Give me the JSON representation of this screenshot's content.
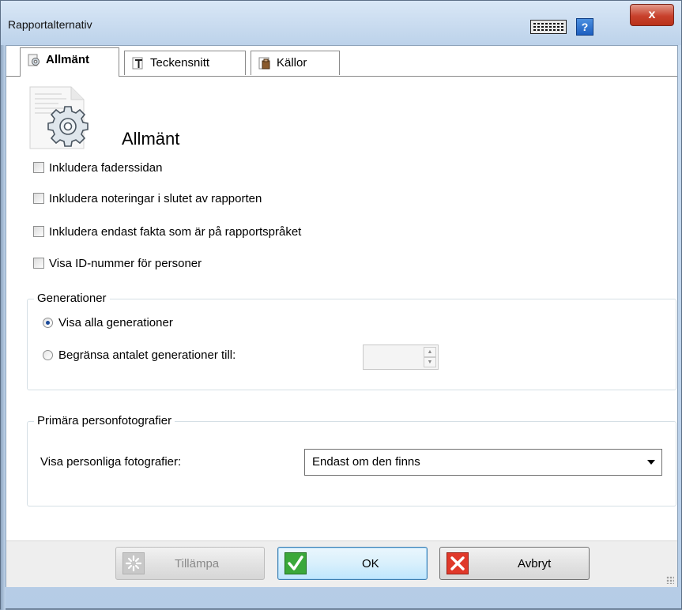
{
  "window": {
    "title": "Rapportalternativ",
    "close_label": "x",
    "help_label": "?"
  },
  "tabs": [
    {
      "label": "Allmänt"
    },
    {
      "label": "Teckensnitt"
    },
    {
      "label": "Källor"
    }
  ],
  "section": {
    "title": "Allmänt"
  },
  "checkboxes": [
    {
      "label": "Inkludera faderssidan",
      "checked": false
    },
    {
      "label": "Inkludera noteringar i slutet av rapporten",
      "checked": false
    },
    {
      "label": "Inkludera endast fakta som är på rapportspråket",
      "checked": false
    },
    {
      "label": "Visa ID-nummer för personer",
      "checked": false
    }
  ],
  "generations": {
    "legend": "Generationer",
    "options": [
      {
        "label": "Visa alla generationer",
        "selected": true
      },
      {
        "label": "Begränsa antalet generationer till:",
        "selected": false
      }
    ],
    "limit_value": ""
  },
  "photos": {
    "legend": "Primära personfotografier",
    "label": "Visa personliga fotografier:",
    "selected": "Endast om den finns"
  },
  "buttons": {
    "apply": "Tillämpa",
    "ok": "OK",
    "cancel": "Avbryt"
  }
}
